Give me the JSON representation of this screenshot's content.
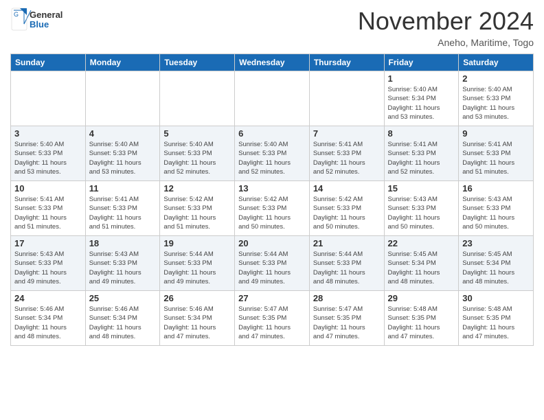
{
  "header": {
    "logo_line1": "General",
    "logo_line2": "Blue",
    "month_title": "November 2024",
    "location": "Aneho, Maritime, Togo"
  },
  "weekdays": [
    "Sunday",
    "Monday",
    "Tuesday",
    "Wednesday",
    "Thursday",
    "Friday",
    "Saturday"
  ],
  "weeks": [
    [
      {
        "day": "",
        "info": ""
      },
      {
        "day": "",
        "info": ""
      },
      {
        "day": "",
        "info": ""
      },
      {
        "day": "",
        "info": ""
      },
      {
        "day": "",
        "info": ""
      },
      {
        "day": "1",
        "info": "Sunrise: 5:40 AM\nSunset: 5:34 PM\nDaylight: 11 hours\nand 53 minutes."
      },
      {
        "day": "2",
        "info": "Sunrise: 5:40 AM\nSunset: 5:33 PM\nDaylight: 11 hours\nand 53 minutes."
      }
    ],
    [
      {
        "day": "3",
        "info": "Sunrise: 5:40 AM\nSunset: 5:33 PM\nDaylight: 11 hours\nand 53 minutes."
      },
      {
        "day": "4",
        "info": "Sunrise: 5:40 AM\nSunset: 5:33 PM\nDaylight: 11 hours\nand 53 minutes."
      },
      {
        "day": "5",
        "info": "Sunrise: 5:40 AM\nSunset: 5:33 PM\nDaylight: 11 hours\nand 52 minutes."
      },
      {
        "day": "6",
        "info": "Sunrise: 5:40 AM\nSunset: 5:33 PM\nDaylight: 11 hours\nand 52 minutes."
      },
      {
        "day": "7",
        "info": "Sunrise: 5:41 AM\nSunset: 5:33 PM\nDaylight: 11 hours\nand 52 minutes."
      },
      {
        "day": "8",
        "info": "Sunrise: 5:41 AM\nSunset: 5:33 PM\nDaylight: 11 hours\nand 52 minutes."
      },
      {
        "day": "9",
        "info": "Sunrise: 5:41 AM\nSunset: 5:33 PM\nDaylight: 11 hours\nand 51 minutes."
      }
    ],
    [
      {
        "day": "10",
        "info": "Sunrise: 5:41 AM\nSunset: 5:33 PM\nDaylight: 11 hours\nand 51 minutes."
      },
      {
        "day": "11",
        "info": "Sunrise: 5:41 AM\nSunset: 5:33 PM\nDaylight: 11 hours\nand 51 minutes."
      },
      {
        "day": "12",
        "info": "Sunrise: 5:42 AM\nSunset: 5:33 PM\nDaylight: 11 hours\nand 51 minutes."
      },
      {
        "day": "13",
        "info": "Sunrise: 5:42 AM\nSunset: 5:33 PM\nDaylight: 11 hours\nand 50 minutes."
      },
      {
        "day": "14",
        "info": "Sunrise: 5:42 AM\nSunset: 5:33 PM\nDaylight: 11 hours\nand 50 minutes."
      },
      {
        "day": "15",
        "info": "Sunrise: 5:43 AM\nSunset: 5:33 PM\nDaylight: 11 hours\nand 50 minutes."
      },
      {
        "day": "16",
        "info": "Sunrise: 5:43 AM\nSunset: 5:33 PM\nDaylight: 11 hours\nand 50 minutes."
      }
    ],
    [
      {
        "day": "17",
        "info": "Sunrise: 5:43 AM\nSunset: 5:33 PM\nDaylight: 11 hours\nand 49 minutes."
      },
      {
        "day": "18",
        "info": "Sunrise: 5:43 AM\nSunset: 5:33 PM\nDaylight: 11 hours\nand 49 minutes."
      },
      {
        "day": "19",
        "info": "Sunrise: 5:44 AM\nSunset: 5:33 PM\nDaylight: 11 hours\nand 49 minutes."
      },
      {
        "day": "20",
        "info": "Sunrise: 5:44 AM\nSunset: 5:33 PM\nDaylight: 11 hours\nand 49 minutes."
      },
      {
        "day": "21",
        "info": "Sunrise: 5:44 AM\nSunset: 5:33 PM\nDaylight: 11 hours\nand 48 minutes."
      },
      {
        "day": "22",
        "info": "Sunrise: 5:45 AM\nSunset: 5:34 PM\nDaylight: 11 hours\nand 48 minutes."
      },
      {
        "day": "23",
        "info": "Sunrise: 5:45 AM\nSunset: 5:34 PM\nDaylight: 11 hours\nand 48 minutes."
      }
    ],
    [
      {
        "day": "24",
        "info": "Sunrise: 5:46 AM\nSunset: 5:34 PM\nDaylight: 11 hours\nand 48 minutes."
      },
      {
        "day": "25",
        "info": "Sunrise: 5:46 AM\nSunset: 5:34 PM\nDaylight: 11 hours\nand 48 minutes."
      },
      {
        "day": "26",
        "info": "Sunrise: 5:46 AM\nSunset: 5:34 PM\nDaylight: 11 hours\nand 47 minutes."
      },
      {
        "day": "27",
        "info": "Sunrise: 5:47 AM\nSunset: 5:35 PM\nDaylight: 11 hours\nand 47 minutes."
      },
      {
        "day": "28",
        "info": "Sunrise: 5:47 AM\nSunset: 5:35 PM\nDaylight: 11 hours\nand 47 minutes."
      },
      {
        "day": "29",
        "info": "Sunrise: 5:48 AM\nSunset: 5:35 PM\nDaylight: 11 hours\nand 47 minutes."
      },
      {
        "day": "30",
        "info": "Sunrise: 5:48 AM\nSunset: 5:35 PM\nDaylight: 11 hours\nand 47 minutes."
      }
    ]
  ]
}
